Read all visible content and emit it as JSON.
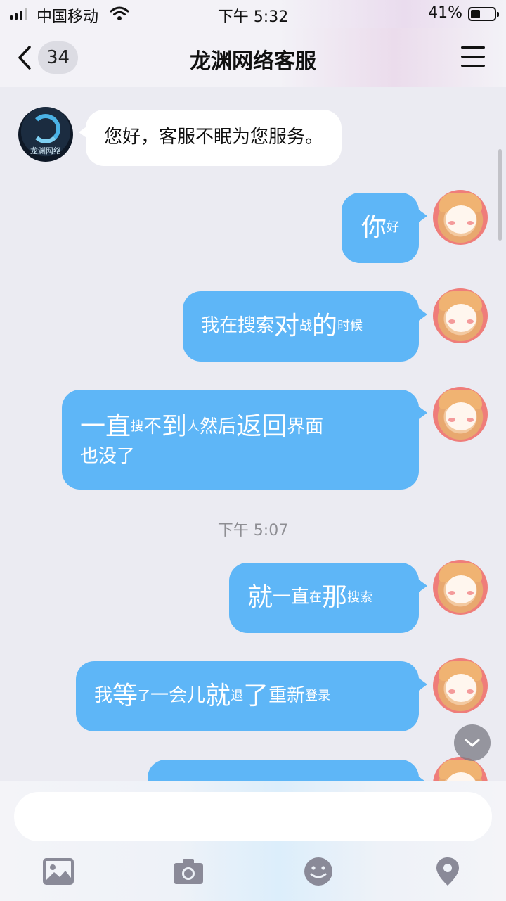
{
  "status_bar": {
    "carrier": "中国移动",
    "time": "下午 5:32",
    "battery_percent": "41%",
    "battery_level": 0.41,
    "signal_bars": 3
  },
  "header": {
    "back_badge_count": "34",
    "title": "龙渊网络客服",
    "back_icon": "chevron-left-icon",
    "menu_icon": "hamburger-menu-icon"
  },
  "colors": {
    "outgoing_bubble": "#5eb6f7",
    "incoming_bubble": "#ffffff",
    "background": "#ebebf2"
  },
  "messages": [
    {
      "sender": "service",
      "avatar_text": "龙渊网络",
      "segments": [
        {
          "text": "您好，客服不眠为您服务。",
          "size": "m"
        }
      ]
    },
    {
      "sender": "me",
      "segments": [
        {
          "text": "你",
          "size": "l"
        },
        {
          "text": "好",
          "size": "s"
        }
      ]
    },
    {
      "sender": "me",
      "segments": [
        {
          "text": "我在搜索",
          "size": "m"
        },
        {
          "text": "对",
          "size": "l"
        },
        {
          "text": "战",
          "size": "s"
        },
        {
          "text": "的",
          "size": "l"
        },
        {
          "text": "时候",
          "size": "s"
        }
      ]
    },
    {
      "sender": "me",
      "segments": [
        {
          "text": "一直",
          "size": "l"
        },
        {
          "text": "搜",
          "size": "s"
        },
        {
          "text": "不",
          "size": "m"
        },
        {
          "text": "到",
          "size": "l"
        },
        {
          "text": "人 ",
          "size": "s"
        },
        {
          "text": "然后",
          "size": "m"
        },
        {
          "text": "返回",
          "size": "l"
        },
        {
          "text": "界面",
          "size": "m"
        },
        {
          "text": "也没了",
          "size": "m"
        }
      ]
    },
    {
      "sender": "me",
      "segments": [
        {
          "text": "就",
          "size": "l"
        },
        {
          "text": "一",
          "size": "m"
        },
        {
          "text": "直",
          "size": "m"
        },
        {
          "text": "在",
          "size": "s"
        },
        {
          "text": "那",
          "size": "l"
        },
        {
          "text": "搜索",
          "size": "s"
        }
      ]
    },
    {
      "sender": "me",
      "segments": [
        {
          "text": "我",
          "size": "m"
        },
        {
          "text": "等",
          "size": "l"
        },
        {
          "text": "了",
          "size": "s"
        },
        {
          "text": "一会儿 ",
          "size": "m"
        },
        {
          "text": "就",
          "size": "l"
        },
        {
          "text": "退",
          "size": "s"
        },
        {
          "text": "了 ",
          "size": "l"
        },
        {
          "text": "重新",
          "size": "m"
        },
        {
          "text": "登录",
          "size": "s"
        }
      ]
    }
  ],
  "time_divider": "下午 5:07",
  "composer": {
    "placeholder": "",
    "tools": [
      "image-icon",
      "camera-icon",
      "emoji-icon",
      "location-icon"
    ]
  }
}
